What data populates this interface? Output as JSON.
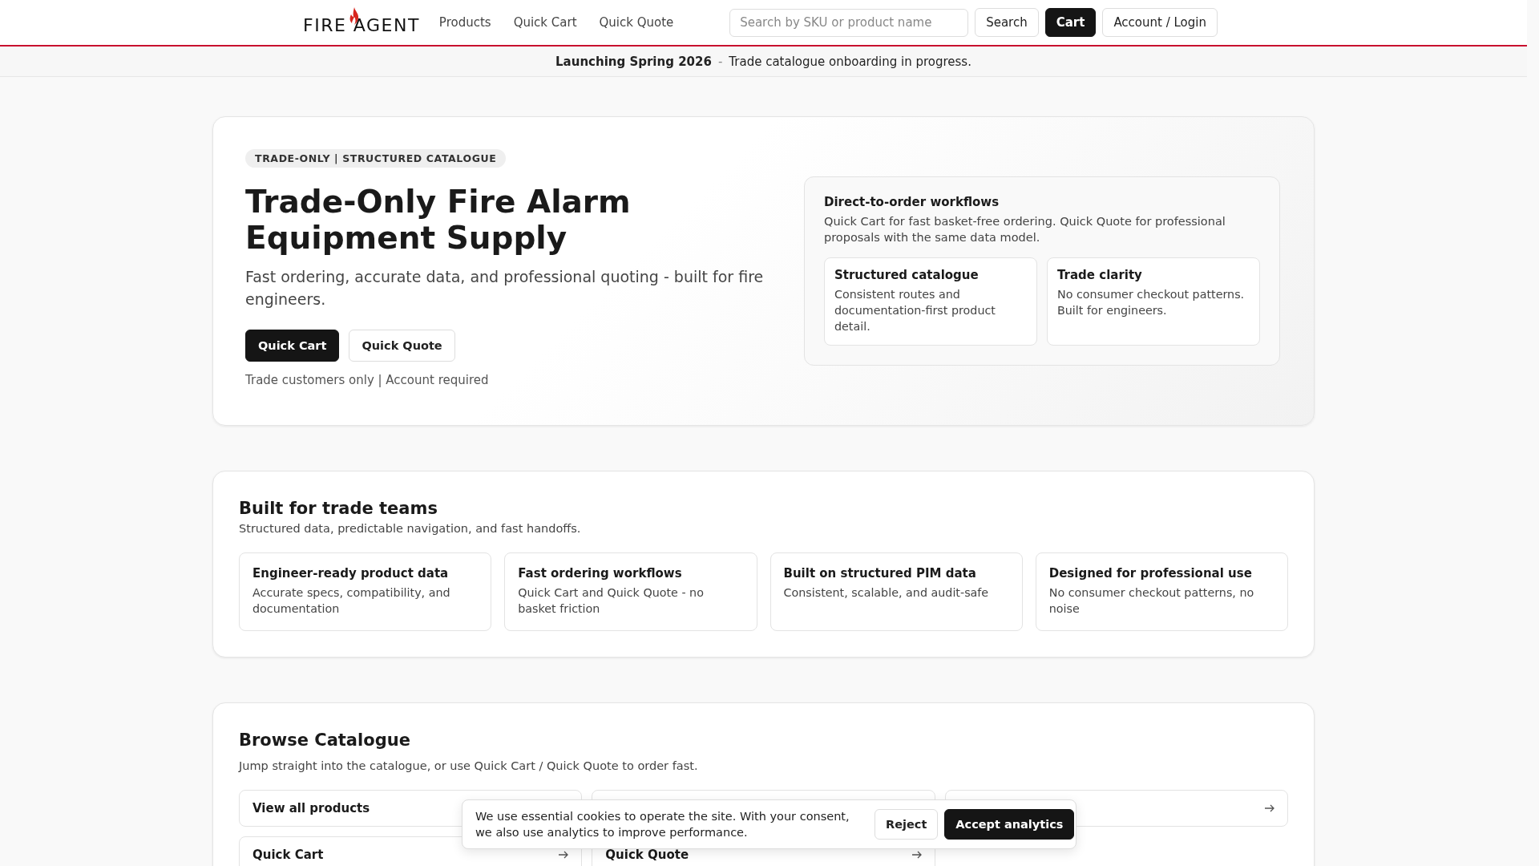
{
  "header": {
    "logo": "FIRE AGENT",
    "nav": [
      "Products",
      "Quick Cart",
      "Quick Quote"
    ],
    "search": {
      "placeholder": "Search by SKU or product name"
    },
    "buttons": [
      {
        "label": "Search",
        "kind": "secondary"
      },
      {
        "label": "Cart",
        "kind": "primary"
      },
      {
        "label": "Account / Login",
        "kind": "secondary"
      }
    ]
  },
  "banner": {
    "highlight": "Launching Spring 2026",
    "separator": "-",
    "text": "Trade catalogue onboarding in progress."
  },
  "hero": {
    "badge": "TRADE-ONLY | STRUCTURED CATALOGUE",
    "title": "Trade-Only Fire Alarm Equipment Supply",
    "subtitle": "Fast ordering, accurate data, and professional quoting - built for fire engineers.",
    "buttons": [
      {
        "label": "Quick Cart",
        "kind": "primary"
      },
      {
        "label": "Quick Quote",
        "kind": "secondary"
      }
    ],
    "note": "Trade customers only | Account required",
    "panel": {
      "title": "Direct-to-order workflows",
      "text": "Quick Cart for fast basket-free ordering. Quick Quote for professional proposals with the same data model.",
      "cards": [
        {
          "title": "Structured catalogue",
          "text": "Consistent routes and documentation-first product detail."
        },
        {
          "title": "Trade clarity",
          "text": "No consumer checkout patterns. Built for engineers."
        }
      ]
    }
  },
  "features": {
    "title": "Built for trade teams",
    "subtitle": "Structured data, predictable navigation, and fast handoffs.",
    "cards": [
      {
        "title": "Engineer-ready product data",
        "text": "Accurate specs, compatibility, and documentation"
      },
      {
        "title": "Fast ordering workflows",
        "text": "Quick Cart and Quick Quote - no basket friction"
      },
      {
        "title": "Built on structured PIM data",
        "text": "Consistent, scalable, and audit-safe"
      },
      {
        "title": "Designed for professional use",
        "text": "No consumer checkout patterns, no noise"
      }
    ]
  },
  "browse": {
    "title": "Browse Catalogue",
    "subtitle": "Jump straight into the catalogue, or use Quick Cart / Quick Quote to order fast.",
    "links": [
      {
        "kind": "plain",
        "label": "View all products"
      },
      {
        "kind": "blank"
      },
      {
        "kind": "arrow"
      },
      {
        "kind": "arrowed",
        "label": "Quick Cart"
      },
      {
        "kind": "arrowed",
        "label": "Quick Quote"
      }
    ]
  },
  "cookie": {
    "text": "We use essential cookies to operate the site. With your consent, we also use analytics to improve performance.",
    "buttons": [
      {
        "label": "Reject",
        "kind": "secondary"
      },
      {
        "label": "Accept analytics",
        "kind": "primary"
      }
    ]
  }
}
